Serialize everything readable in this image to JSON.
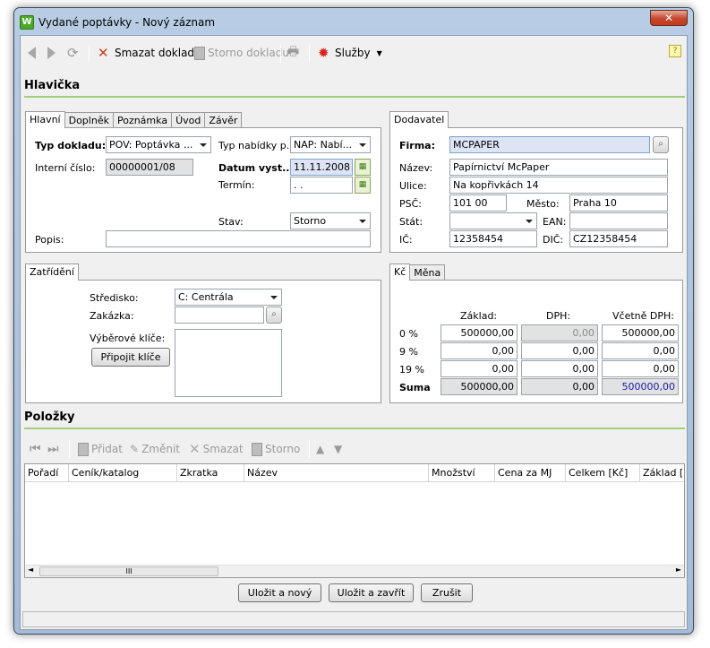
{
  "window": {
    "title": "Vydané poptávky - Nový záznam",
    "app_icon_letter": "W",
    "close_glyph": "✕"
  },
  "toolbar": {
    "delete_label": "Smazat doklad",
    "cancel_label": "Storno dokladu",
    "services_label": "Služby",
    "help_glyph": "?"
  },
  "header": {
    "title": "Hlavička",
    "tabs": [
      "Hlavní",
      "Doplněk",
      "Poznámka",
      "Úvod",
      "Závěr"
    ],
    "doc_type_label": "Typ dokladu:",
    "doc_type_value": "POV: Poptávka ...",
    "offer_type_label": "Typ nabídky p...",
    "offer_type_value": "NAP: Nabí...",
    "internal_no_label": "Interní číslo:",
    "internal_no_value": "00000001/08",
    "issue_date_label": "Datum vyst...",
    "issue_date_value": "11.11.2008",
    "deadline_label": "Termín:",
    "deadline_value": " .  .",
    "state_label": "Stav:",
    "state_value": "Storno",
    "desc_label": "Popis:",
    "desc_value": ""
  },
  "supplier": {
    "tab": "Dodavatel",
    "firm_label": "Firma:",
    "firm_value": "MCPAPER",
    "name_label": "Název:",
    "name_value": "Papírnictví McPaper",
    "street_label": "Ulice:",
    "street_value": "Na kopřivkách 14",
    "zip_label": "PSČ:",
    "zip_value": "101 00",
    "city_label": "Město:",
    "city_value": "Praha 10",
    "state_label": "Stát:",
    "state_value": "",
    "ean_label": "EAN:",
    "ean_value": "",
    "ic_label": "IČ:",
    "ic_value": "12358454",
    "dic_label": "DIČ:",
    "dic_value": "CZ12358454"
  },
  "classification": {
    "tab": "Zatřídění",
    "center_label": "Středisko:",
    "center_value": "C: Centrála",
    "order_label": "Zakázka:",
    "order_value": "",
    "keys_label": "Výběrové klíče:",
    "attach_keys_button": "Připojit klíče"
  },
  "totals": {
    "tabs": [
      "Kč",
      "Měna"
    ],
    "col_base": "Základ:",
    "col_vat": "DPH:",
    "col_incl": "Včetně DPH:",
    "rows": [
      {
        "label": "0 %",
        "base": "500000,00",
        "vat": "0,00",
        "incl": "500000,00"
      },
      {
        "label": "9 %",
        "base": "0,00",
        "vat": "0,00",
        "incl": "0,00"
      },
      {
        "label": "19 %",
        "base": "0,00",
        "vat": "0,00",
        "incl": "0,00"
      },
      {
        "label": "Suma",
        "base": "500000,00",
        "vat": "0,00",
        "incl": "500000,00"
      }
    ]
  },
  "items": {
    "title": "Položky",
    "add_label": "Přidat",
    "edit_label": "Změnit",
    "delete_label": "Smazat",
    "cancel_label": "Storno",
    "columns": [
      "Pořadí",
      "Ceník/katalog",
      "Zkratka",
      "Název",
      "Množství",
      "Cena za MJ",
      "Celkem [Kč]",
      "Základ ["
    ],
    "scroll_grip": "III"
  },
  "footer": {
    "save_new": "Uložit a nový",
    "save_close": "Uložit a zavřít",
    "cancel": "Zrušit"
  },
  "colors": {
    "section_line": "#9fd07e",
    "highlight_field": "#dde4f4",
    "blue_value": "#1a1aa8"
  }
}
